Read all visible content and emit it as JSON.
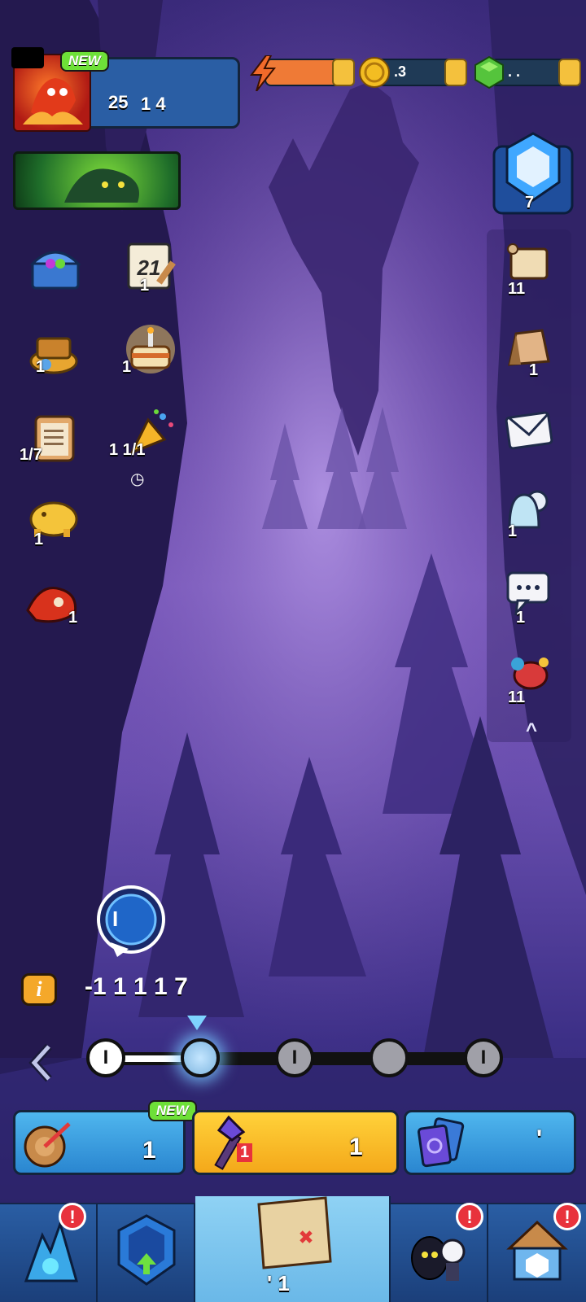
{
  "header": {
    "new_badge": "NEW",
    "player_level": "25",
    "player_score": "1 4",
    "energy_value": "",
    "coins_value": ".3",
    "gems_value": ".  ."
  },
  "rank_emblem": {
    "label": "7"
  },
  "left_icons": [
    {
      "name": "treasure-chest-icon",
      "label": ""
    },
    {
      "name": "calendar-icon",
      "label": "21",
      "caption": "1"
    },
    {
      "name": "gold-pile-icon",
      "label": "1"
    },
    {
      "name": "birthday-cake-icon",
      "label": "1"
    },
    {
      "name": "quest-clipboard-icon",
      "label": "1/7"
    },
    {
      "name": "party-popper-icon",
      "label": "1  1/1",
      "timer": "◷"
    },
    {
      "name": "piggy-bank-icon",
      "label": "1"
    },
    {
      "name": "dragon-hero-icon",
      "label": "1"
    }
  ],
  "right_icons": [
    {
      "name": "scroll-icon",
      "label": "11"
    },
    {
      "name": "bag-icon",
      "label": "1"
    },
    {
      "name": "mail-icon",
      "label": ""
    },
    {
      "name": "friends-icon",
      "label": "1"
    },
    {
      "name": "chat-icon",
      "label": "1"
    },
    {
      "name": "event-creature-icon",
      "label": "11"
    },
    {
      "name": "chevron-up-icon",
      "label": "^"
    }
  ],
  "stage": {
    "hero_badge": "I",
    "stage_name": "-1 1 1 1 7",
    "info_icon": "i",
    "nodes": [
      "I",
      "",
      "I",
      "",
      "I"
    ],
    "current_index": 1
  },
  "modes": [
    {
      "name": "archery-mode",
      "new_badge": "NEW",
      "label": "1"
    },
    {
      "name": "battle-mode",
      "label": "1",
      "count": "1"
    },
    {
      "name": "cards-mode",
      "label": "'"
    }
  ],
  "bottom_nav": [
    {
      "name": "nav-heroes",
      "alert": "!"
    },
    {
      "name": "nav-upgrade",
      "alert": ""
    },
    {
      "name": "nav-map",
      "label": "' 1",
      "alert": ""
    },
    {
      "name": "nav-guild",
      "alert": "!"
    },
    {
      "name": "nav-shop",
      "alert": "!"
    }
  ],
  "colors": {
    "accent": "#f4c13d",
    "primary": "#2a5ea4",
    "energy": "#ef7a36",
    "gem": "#55c43c",
    "alert": "#e8323c"
  }
}
